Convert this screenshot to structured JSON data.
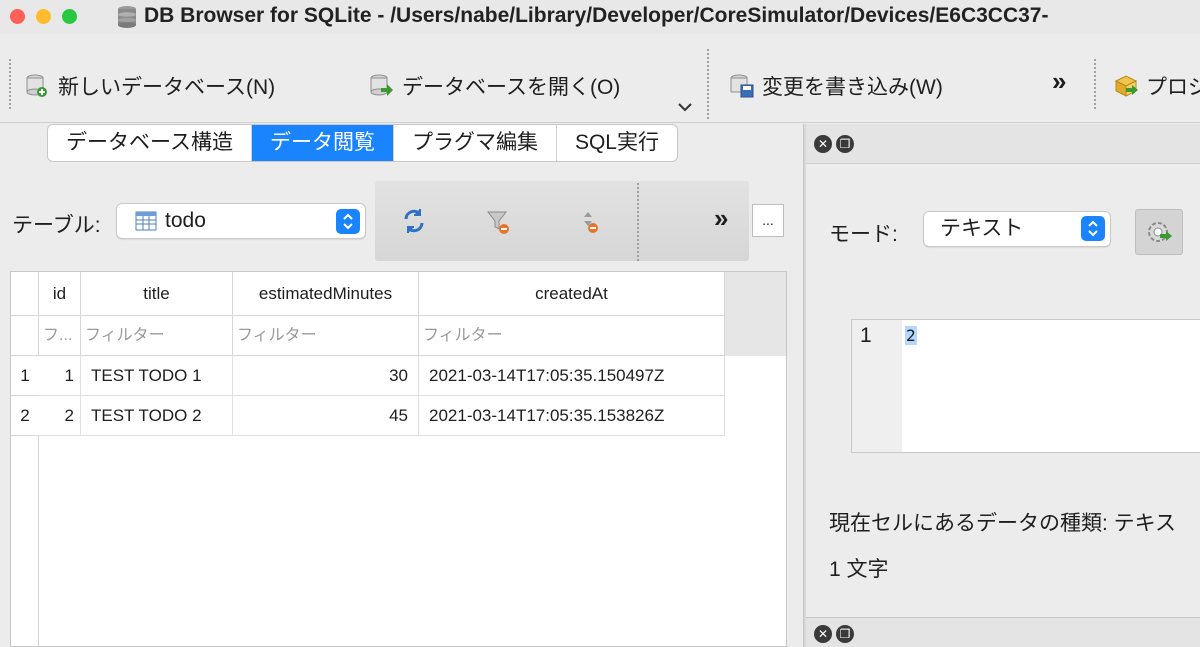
{
  "window": {
    "title": "DB Browser for SQLite - /Users/nabe/Library/Developer/CoreSimulator/Devices/E6C3CC37-"
  },
  "toolbar": {
    "new_db": "新しいデータベース(N)",
    "open_db": "データベースを開く(O)",
    "write_changes": "変更を書き込み(W)",
    "more": "»",
    "project": "プロジ"
  },
  "tabs": [
    {
      "label": "データベース構造",
      "active": false
    },
    {
      "label": "データ閲覧",
      "active": true
    },
    {
      "label": "プラグマ編集",
      "active": false
    },
    {
      "label": "SQL実行",
      "active": false
    }
  ],
  "browse": {
    "table_label": "テーブル:",
    "selected_table": "todo",
    "more": "»",
    "dots": "..."
  },
  "grid": {
    "columns": [
      "id",
      "title",
      "estimatedMinutes",
      "createdAt"
    ],
    "filters": [
      "フ...",
      "フィルター",
      "フィルター",
      "フィルター"
    ],
    "rows": [
      {
        "rownum": "1",
        "id": "1",
        "title": "TEST TODO 1",
        "estimatedMinutes": "30",
        "createdAt": "2021-03-14T17:05:35.150497Z"
      },
      {
        "rownum": "2",
        "id": "2",
        "title": "TEST TODO 2",
        "estimatedMinutes": "45",
        "createdAt": "2021-03-14T17:05:35.153826Z"
      }
    ]
  },
  "edit_cell": {
    "mode_label": "モード:",
    "mode_value": "テキスト",
    "line_number": "1",
    "value": "2",
    "cell_type": "現在セルにあるデータの種類: テキス",
    "char_count": "1 文字"
  },
  "colors": {
    "accent": "#1a84ff",
    "selection": "#b3d7ff"
  }
}
